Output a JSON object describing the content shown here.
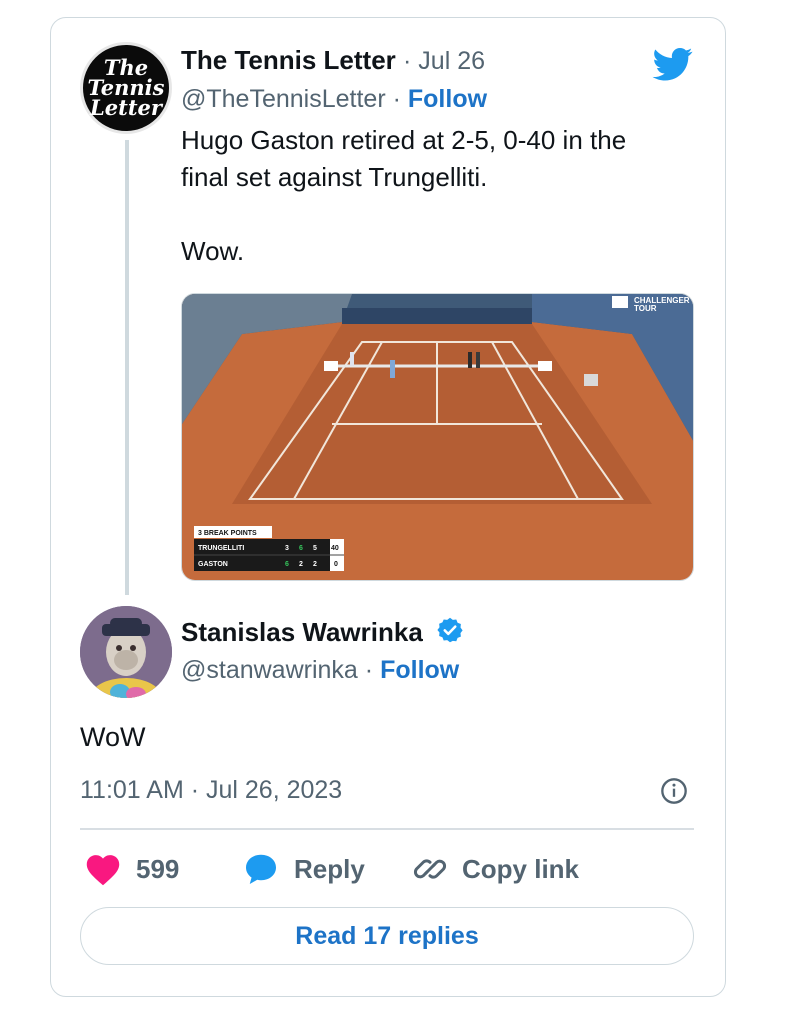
{
  "tweet": {
    "author_name": "The Tennis Letter",
    "date": "· Jul 26",
    "handle": "@TheTennisLetter",
    "separator": "·",
    "follow_label": "Follow",
    "text_line1": "Hugo Gaston retired at 2-5, 0-40 in the",
    "text_line2": "final set against Trungelliti.",
    "text_line3": "Wow.",
    "avatar_text": [
      "The",
      "Tennis",
      "Letter"
    ]
  },
  "media": {
    "broadcast_logo_line1": "CHALLENGER",
    "broadcast_logo_line2": "TOUR",
    "scoreboard": {
      "header": "3 BREAK POINTS",
      "players": [
        {
          "name": "TRUNGELLITI",
          "sets": [
            "3",
            "6",
            "5"
          ],
          "points": "40"
        },
        {
          "name": "GASTON",
          "sets": [
            "6",
            "2",
            "2"
          ],
          "points": "0"
        }
      ]
    }
  },
  "reply": {
    "author_name": "Stanislas Wawrinka",
    "handle": "@stanwawrinka",
    "separator": "·",
    "follow_label": "Follow",
    "text": "WoW",
    "timestamp": "11:01 AM · Jul 26, 2023"
  },
  "actions": {
    "likes": "599",
    "reply_label": "Reply",
    "copy_link_label": "Copy link",
    "read_replies_label": "Read 17 replies"
  },
  "colors": {
    "accent": "#1d73c7",
    "heart": "#f91880",
    "twitter_blue": "#1d9bf0",
    "clay": "#c56b3c"
  },
  "icons": [
    "twitter-bird-icon",
    "verified-badge-icon",
    "info-icon",
    "heart-icon",
    "reply-bubble-icon",
    "link-icon"
  ]
}
